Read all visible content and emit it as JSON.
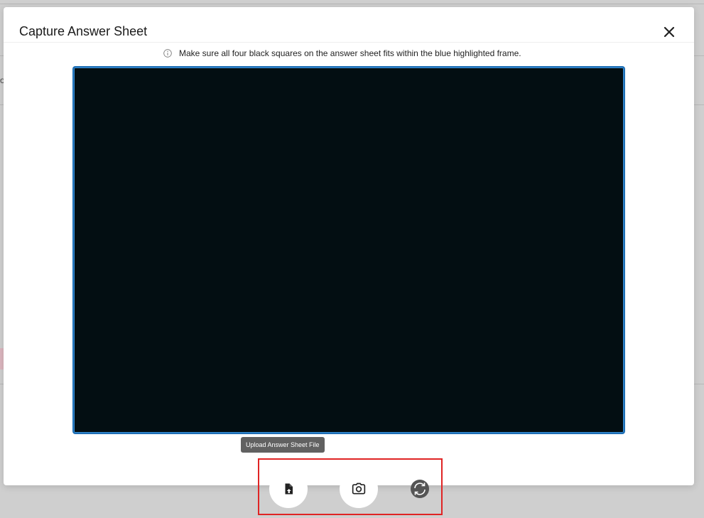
{
  "modal": {
    "title": "Capture Answer Sheet",
    "hint": "Make sure all four black squares on the answer sheet fits within the blue highlighted frame."
  },
  "background": {
    "fragment_text": "o"
  },
  "controls": {
    "upload_tooltip": "Upload Answer Sheet File",
    "upload_icon": "file-upload-icon",
    "capture_icon": "camera-icon",
    "switch_icon": "camera-switch-icon"
  },
  "colors": {
    "frame_border": "#1f6fb5",
    "camera_feed": "#030e12",
    "highlight": "#e02424"
  }
}
